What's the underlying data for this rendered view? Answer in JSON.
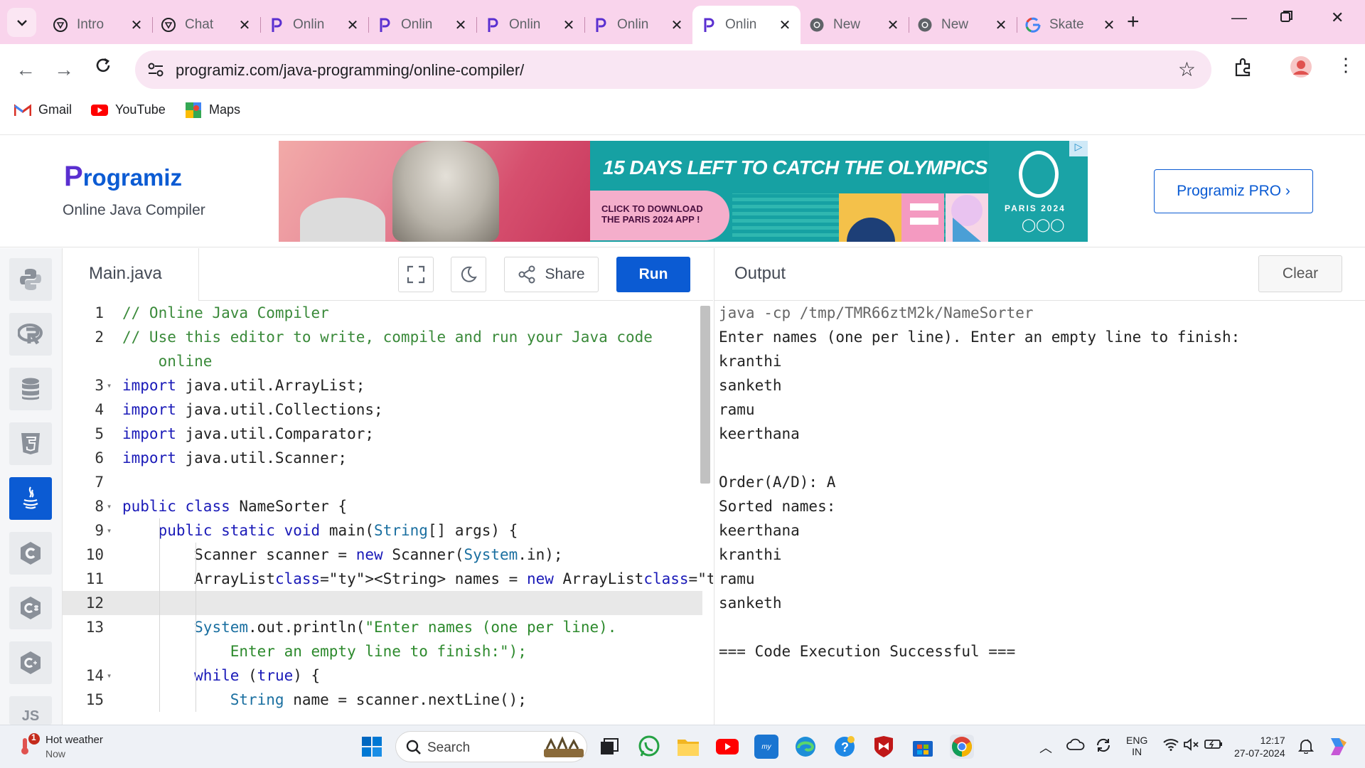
{
  "browser": {
    "tabs": [
      {
        "title": "Intro",
        "icon": "chatgpt-icon",
        "active": false
      },
      {
        "title": "Chat",
        "icon": "chatgpt-icon",
        "active": false
      },
      {
        "title": "Onlin",
        "icon": "programiz-icon",
        "active": false
      },
      {
        "title": "Onlin",
        "icon": "programiz-icon",
        "active": false
      },
      {
        "title": "Onlin",
        "icon": "programiz-icon",
        "active": false
      },
      {
        "title": "Onlin",
        "icon": "programiz-icon",
        "active": false
      },
      {
        "title": "Onlin",
        "icon": "programiz-icon",
        "active": true
      },
      {
        "title": "New",
        "icon": "chrome-icon",
        "active": false
      },
      {
        "title": "New",
        "icon": "chrome-icon",
        "active": false
      },
      {
        "title": "Skate",
        "icon": "google-icon",
        "active": false
      }
    ],
    "url": "programiz.com/java-programming/online-compiler/",
    "bookmarks": [
      {
        "label": "Gmail",
        "icon": "gmail-icon"
      },
      {
        "label": "YouTube",
        "icon": "youtube-icon"
      },
      {
        "label": "Maps",
        "icon": "maps-icon"
      }
    ]
  },
  "header": {
    "logo": "rogramiz",
    "logo_initial": "P",
    "subtitle": "Online Java Compiler",
    "pro_button": "Programiz PRO ›",
    "ad": {
      "headline": "15 DAYS LEFT TO CATCH THE OLYMPICS",
      "cta": "CLICK TO DOWNLOAD THE PARIS 2024 APP !",
      "brand": "PARIS 2024"
    }
  },
  "editor": {
    "filename": "Main.java",
    "share_label": "Share",
    "run_label": "Run",
    "lines": [
      {
        "n": "1",
        "fold": "",
        "text": "// Online Java Compiler"
      },
      {
        "n": "2",
        "fold": "",
        "text": "// Use this editor to write, compile and run your Java code"
      },
      {
        "n": "",
        "fold": "",
        "text": "    online"
      },
      {
        "n": "3",
        "fold": "▾",
        "text": "import java.util.ArrayList;"
      },
      {
        "n": "4",
        "fold": "",
        "text": "import java.util.Collections;"
      },
      {
        "n": "5",
        "fold": "",
        "text": "import java.util.Comparator;"
      },
      {
        "n": "6",
        "fold": "",
        "text": "import java.util.Scanner;"
      },
      {
        "n": "7",
        "fold": "",
        "text": ""
      },
      {
        "n": "8",
        "fold": "▾",
        "text": "public class NameSorter {"
      },
      {
        "n": "9",
        "fold": "▾",
        "text": "    public static void main(String[] args) {"
      },
      {
        "n": "10",
        "fold": "",
        "text": "        Scanner scanner = new Scanner(System.in);"
      },
      {
        "n": "11",
        "fold": "",
        "text": "        ArrayList<String> names = new ArrayList<>();"
      },
      {
        "n": "12",
        "fold": "",
        "text": ""
      },
      {
        "n": "13",
        "fold": "",
        "text": "        System.out.println(\"Enter names (one per line)."
      },
      {
        "n": "",
        "fold": "",
        "text": "            Enter an empty line to finish:\");"
      },
      {
        "n": "14",
        "fold": "▾",
        "text": "        while (true) {"
      },
      {
        "n": "15",
        "fold": "",
        "text": "            String name = scanner.nextLine();"
      }
    ]
  },
  "output": {
    "label": "Output",
    "clear_label": "Clear",
    "lines": [
      "java -cp /tmp/TMR66ztM2k/NameSorter",
      "Enter names (one per line). Enter an empty line to finish:",
      "kranthi",
      "sanketh",
      "ramu",
      "keerthana",
      "",
      "Order(A/D): A",
      "Sorted names:",
      "keerthana",
      "kranthi",
      "ramu",
      "sanketh",
      "",
      "=== Code Execution Successful ==="
    ]
  },
  "taskbar": {
    "weather_title": "Hot weather",
    "weather_sub": "Now",
    "weather_badge": "1",
    "search_label": "Search",
    "lang_line1": "ENG",
    "lang_line2": "IN",
    "time": "12:17",
    "date": "27-07-2024"
  },
  "colors": {
    "accent": "#0b5bd3",
    "tabbar": "#f9d4ec",
    "ad_teal": "#16a1a3"
  }
}
